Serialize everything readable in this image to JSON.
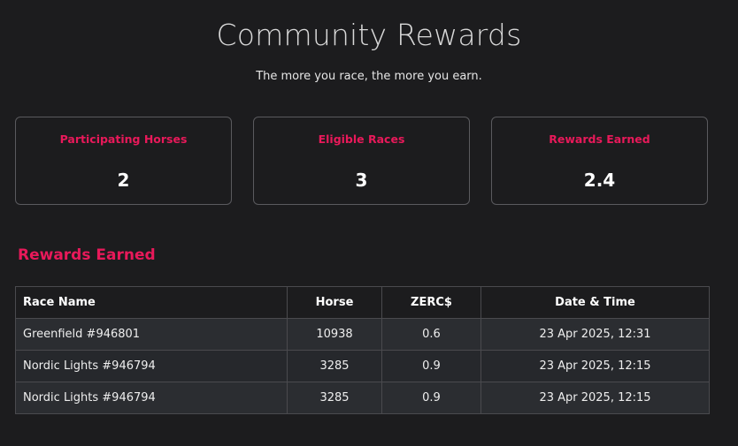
{
  "header": {
    "title": "Community Rewards",
    "subtitle": "The more you race, the more you earn."
  },
  "stats": [
    {
      "label": "Participating Horses",
      "value": "2"
    },
    {
      "label": "Eligible Races",
      "value": "3"
    },
    {
      "label": "Rewards Earned",
      "value": "2.4"
    }
  ],
  "rewards": {
    "section_title": "Rewards Earned",
    "columns": [
      "Race Name",
      "Horse",
      "ZERC$",
      "Date & Time"
    ],
    "rows": [
      [
        "Greenfield #946801",
        "10938",
        "0.6",
        "23 Apr 2025, 12:31"
      ],
      [
        "Nordic Lights #946794",
        "3285",
        "0.9",
        "23 Apr 2025, 12:15"
      ],
      [
        "Nordic Lights #946794",
        "3285",
        "0.9",
        "23 Apr 2025, 12:15"
      ]
    ]
  },
  "colors": {
    "background": "#1c1c1e",
    "accent": "#e8195a",
    "border": "#5a5a5e"
  }
}
